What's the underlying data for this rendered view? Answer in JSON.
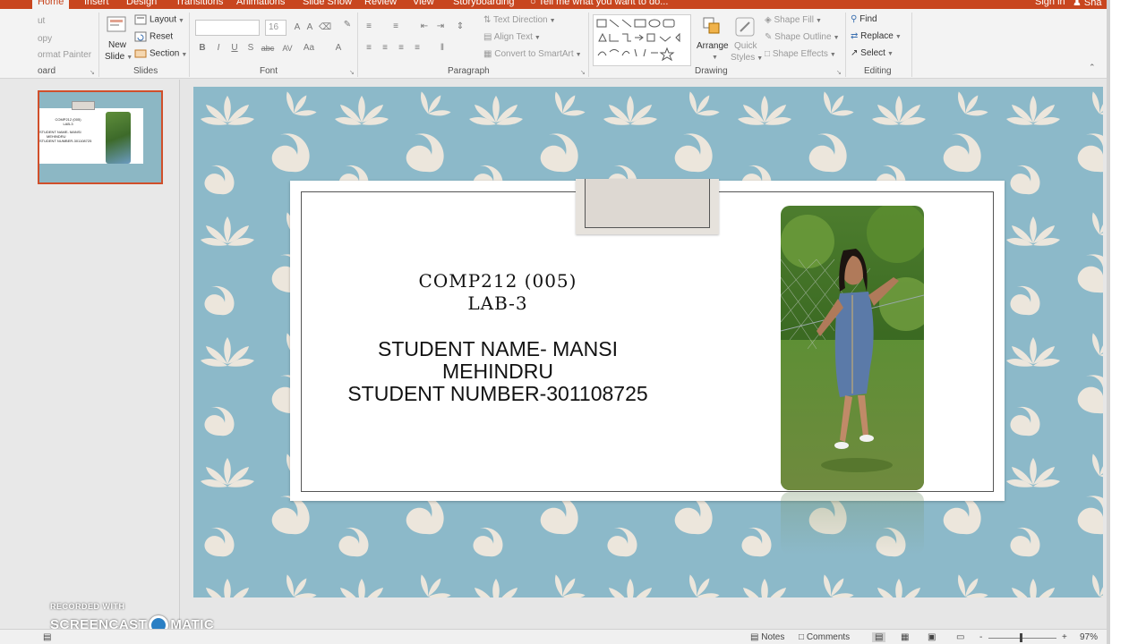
{
  "tabs": [
    {
      "label": "Home",
      "active": true
    },
    {
      "label": "Insert"
    },
    {
      "label": "Design"
    },
    {
      "label": "Transitions"
    },
    {
      "label": "Animations"
    },
    {
      "label": "Slide Show"
    },
    {
      "label": "Review"
    },
    {
      "label": "View"
    },
    {
      "label": "Storyboarding"
    }
  ],
  "tell_me": "Tell me what you want to do...",
  "sign_in": "Sign in",
  "share": "Sha",
  "ribbon": {
    "clipboard": {
      "cut": "ut",
      "copy": "opy",
      "format_painter": "ormat Painter",
      "label": "oard"
    },
    "slides": {
      "new_slide": "New",
      "new_slide2": "Slide",
      "layout": "Layout",
      "reset": "Reset",
      "section": "Section",
      "label": "Slides"
    },
    "font": {
      "size": "16",
      "label": "Font",
      "bold": "B",
      "italic": "I",
      "underline": "U",
      "shadow": "S",
      "strike": "abc",
      "spacing": "AV",
      "case": "Aa",
      "color": "A"
    },
    "paragraph": {
      "text_direction": "Text Direction",
      "align_text": "Align Text",
      "convert_smartart": "Convert to SmartArt",
      "label": "Paragraph"
    },
    "drawing": {
      "arrange": "Arrange",
      "quick_styles": "Quick",
      "quick_styles2": "Styles",
      "shape_fill": "Shape Fill",
      "shape_outline": "Shape Outline",
      "shape_effects": "Shape Effects",
      "label": "Drawing"
    },
    "editing": {
      "find": "Find",
      "replace": "Replace",
      "select": "Select",
      "label": "Editing"
    }
  },
  "thumbnail": {
    "line1": "COMP212 (005)",
    "line2": "LAB-3",
    "line3": "STUDENT NAME- MANSI",
    "line4": "MEHINDRU",
    "line5": "STUDENT NUMBER-301108725"
  },
  "slide": {
    "title_line1": "COMP212 (005)",
    "title_line2": "LAB-3",
    "body_line1": "STUDENT NAME- MANSI",
    "body_line2": "MEHINDRU",
    "body_line3": "STUDENT NUMBER-301108725"
  },
  "watermark": {
    "line1": "RECORDED WITH",
    "left": "SCREENCAST",
    "right": "MATIC"
  },
  "status": {
    "notes": "Notes",
    "comments": "Comments",
    "zoom": "97%",
    "minus": "-",
    "plus": "+"
  },
  "colors": {
    "accent": "#c8461f",
    "slide_bg": "#8cb9c9",
    "motif": "#ece6dc"
  }
}
